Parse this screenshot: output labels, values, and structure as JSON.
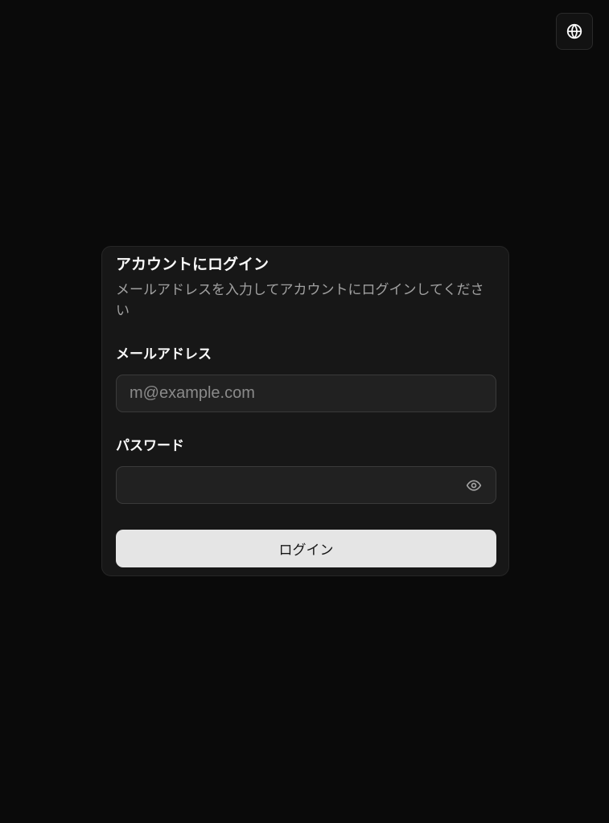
{
  "header": {
    "language_button_icon": "globe-icon"
  },
  "login_card": {
    "title": "アカウントにログイン",
    "description": "メールアドレスを入力してアカウントにログインしてください",
    "email": {
      "label": "メールアドレス",
      "placeholder": "m@example.com",
      "value": ""
    },
    "password": {
      "label": "パスワード",
      "placeholder": "",
      "value": "",
      "toggle_icon": "eye-icon"
    },
    "submit_label": "ログイン"
  },
  "colors": {
    "background": "#0a0a0a",
    "card": "#171717",
    "input": "#212121",
    "button": "#e5e5e5",
    "muted_text": "#a1a1a1"
  }
}
